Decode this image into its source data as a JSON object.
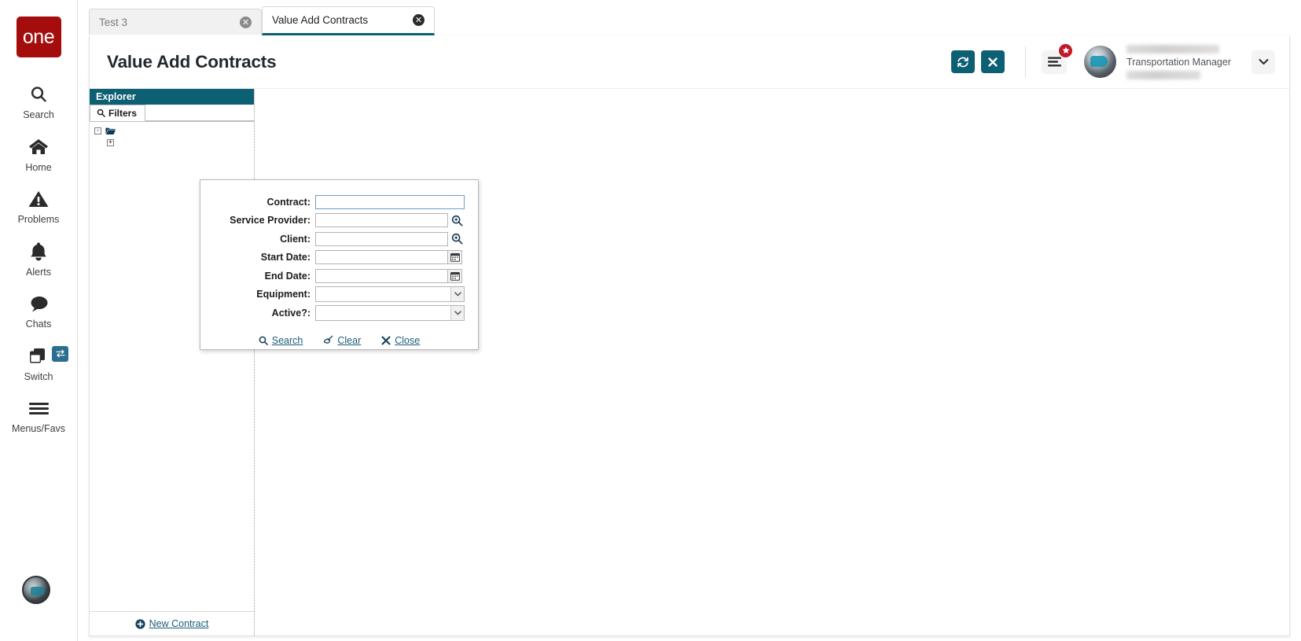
{
  "brand": {
    "logo_text": "one",
    "logo_color": "#a50d0d"
  },
  "theme": {
    "teal": "#0d5f73",
    "link": "#1b5d78",
    "badge_red": "#c0182a"
  },
  "rail": {
    "items": [
      {
        "label": "Search",
        "icon": "search-icon"
      },
      {
        "label": "Home",
        "icon": "home-icon"
      },
      {
        "label": "Problems",
        "icon": "warning-triangle-icon"
      },
      {
        "label": "Alerts",
        "icon": "bell-icon"
      },
      {
        "label": "Chats",
        "icon": "chat-bubble-icon"
      },
      {
        "label": "Switch",
        "icon": "switch-windows-icon",
        "badge_icon": "swap-arrows-icon"
      },
      {
        "label": "Menus/Favs",
        "icon": "hamburger-icon"
      }
    ]
  },
  "tabs": [
    {
      "label": "Test 3",
      "active": false,
      "close_icon": "close-circle-icon"
    },
    {
      "label": "Value Add Contracts",
      "active": true,
      "close_icon": "close-circle-icon"
    }
  ],
  "header": {
    "title": "Value Add Contracts",
    "refresh_icon": "refresh-icon",
    "close_icon": "close-x-icon",
    "menu_icon": "hamburger-menu-icon",
    "menu_badge_icon": "star-badge-icon",
    "avatar_icon": "user-avatar",
    "user_role": "Transportation Manager",
    "caret_icon": "chevron-down-icon"
  },
  "explorer": {
    "title": "Explorer",
    "tab_label": "Filters",
    "tab_icon": "search-icon",
    "tree": [
      {
        "toggle": "-",
        "icon": "folder-open-icon",
        "indent": 0
      },
      {
        "toggle": "+",
        "icon": "",
        "indent": 1
      }
    ],
    "footer": {
      "icon": "plus-circle-icon",
      "label": "New Contract"
    }
  },
  "filter_dialog": {
    "fields": [
      {
        "label": "Contract:",
        "value": "",
        "control": "text",
        "focused": true,
        "accessory": "none"
      },
      {
        "label": "Service Provider:",
        "value": "",
        "control": "text",
        "focused": false,
        "accessory": "search-icon"
      },
      {
        "label": "Client:",
        "value": "",
        "control": "text",
        "focused": false,
        "accessory": "search-icon"
      },
      {
        "label": "Start Date:",
        "value": "",
        "control": "text",
        "focused": false,
        "accessory": "calendar-icon"
      },
      {
        "label": "End Date:",
        "value": "",
        "control": "text",
        "focused": false,
        "accessory": "calendar-icon"
      },
      {
        "label": "Equipment:",
        "value": "",
        "control": "select",
        "focused": false,
        "accessory": "chevron-down-icon"
      },
      {
        "label": "Active?:",
        "value": "",
        "control": "select",
        "focused": false,
        "accessory": "chevron-down-icon"
      }
    ],
    "actions": [
      {
        "label": "Search",
        "icon": "search-icon"
      },
      {
        "label": "Clear",
        "icon": "broom-icon"
      },
      {
        "label": "Close",
        "icon": "close-x-icon"
      }
    ]
  }
}
